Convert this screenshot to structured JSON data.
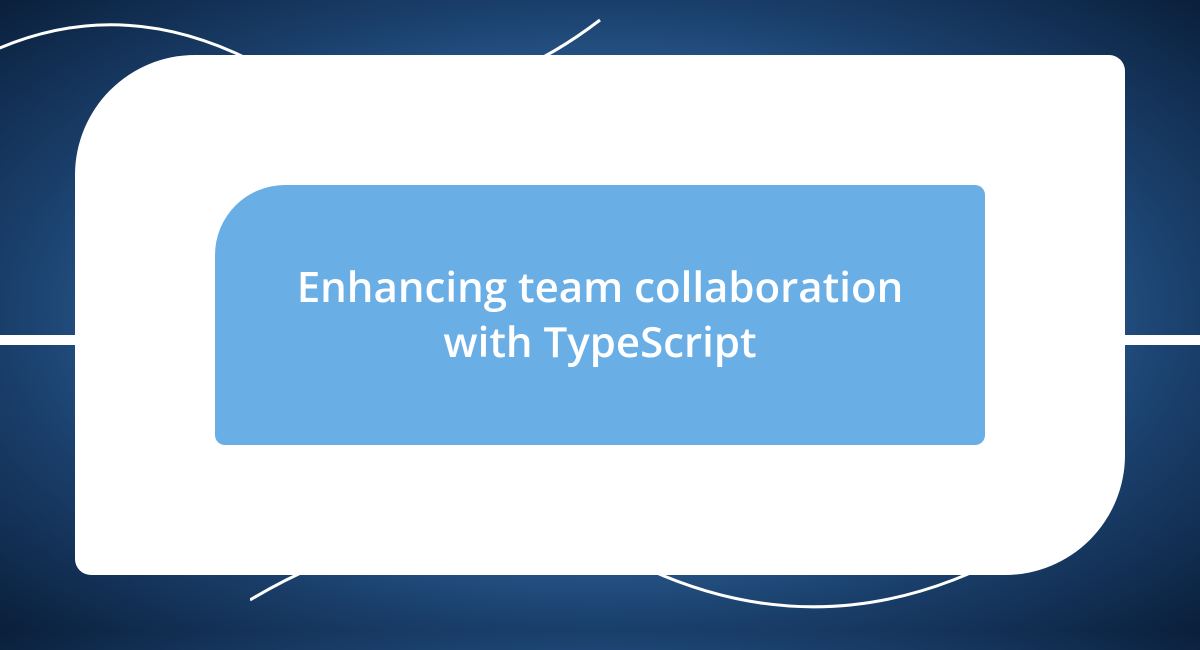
{
  "card": {
    "title": "Enhancing team collaboration with TypeScript"
  },
  "colors": {
    "innerCardBg": "#6aaee6",
    "outerCardBg": "#ffffff",
    "textColor": "#ffffff"
  }
}
